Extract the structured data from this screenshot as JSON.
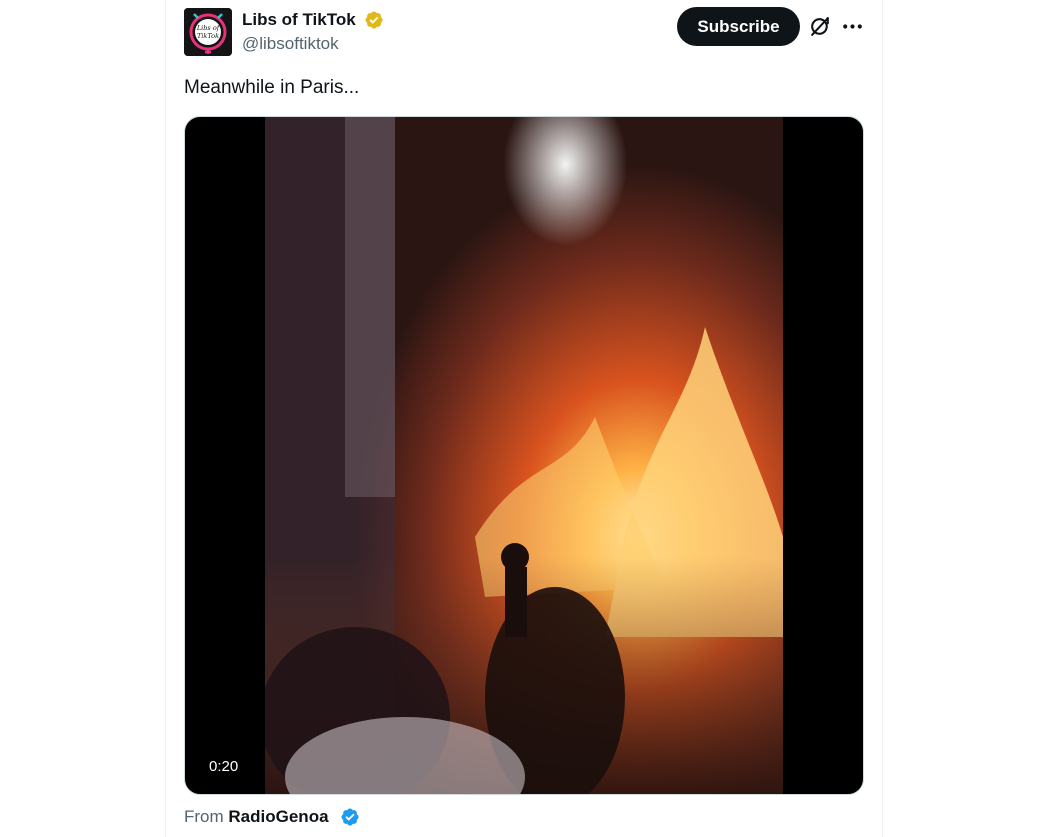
{
  "tweet": {
    "author": {
      "name": "Libs of TikTok",
      "handle": "@libsoftiktok",
      "avatar_text": "Libs of TikTok",
      "badge": "gold-verified-icon",
      "badge_color": "#e2b719"
    },
    "subscribe_label": "Subscribe",
    "grok_icon": "grok-icon",
    "more_icon": "more-icon",
    "text": "Meanwhile in Paris...",
    "media": {
      "type": "video",
      "duration": "0:20"
    },
    "source": {
      "prefix": "From",
      "name": "RadioGenoa",
      "badge": "blue-verified-icon",
      "badge_color": "#1d9bf0"
    }
  },
  "colors": {
    "text_primary": "#0f1419",
    "text_secondary": "#536471",
    "button_bg": "#0f1419"
  }
}
